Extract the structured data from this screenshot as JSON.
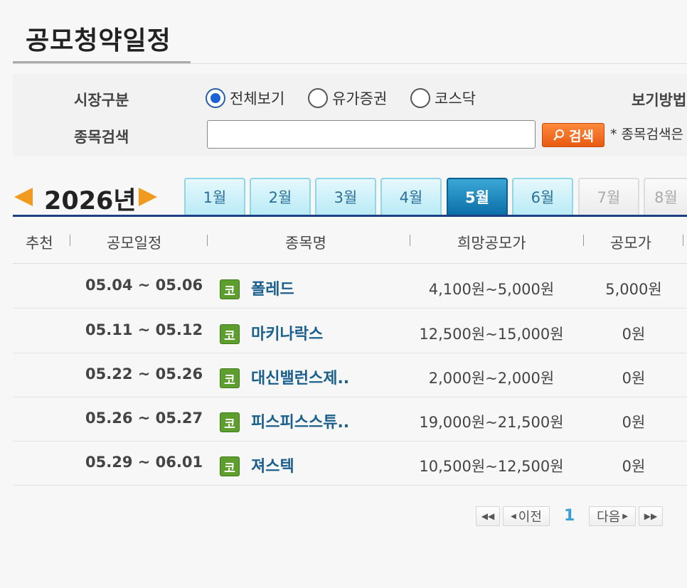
{
  "page": {
    "title": "공모청약일정"
  },
  "filter": {
    "market_label": "시장구분",
    "options": [
      {
        "label": "전체보기",
        "selected": true
      },
      {
        "label": "유가증권",
        "selected": false
      },
      {
        "label": "코스닥",
        "selected": false
      }
    ],
    "view_label": "보기방법",
    "search_label": "종목검색",
    "search_value": "",
    "search_button": "검색",
    "search_note": "* 종목검색은"
  },
  "calendar": {
    "year": "2026년",
    "months": [
      {
        "label": "1월",
        "state": "normal"
      },
      {
        "label": "2월",
        "state": "normal"
      },
      {
        "label": "3월",
        "state": "normal"
      },
      {
        "label": "4월",
        "state": "normal"
      },
      {
        "label": "5월",
        "state": "active"
      },
      {
        "label": "6월",
        "state": "normal"
      },
      {
        "label": "7월",
        "state": "disabled"
      },
      {
        "label": "8월",
        "state": "disabled"
      }
    ]
  },
  "table": {
    "headers": [
      "추천",
      "공모일정",
      "종목명",
      "희망공모가",
      "공모가"
    ],
    "rows": [
      {
        "recommend": "",
        "period": "05.04 ~ 05.06",
        "market": "코",
        "name": "폴레드",
        "hope_price": "4,100원~5,000원",
        "price": "5,000원"
      },
      {
        "recommend": "",
        "period": "05.11 ~ 05.12",
        "market": "코",
        "name": "마키나락스",
        "hope_price": "12,500원~15,000원",
        "price": "0원"
      },
      {
        "recommend": "",
        "period": "05.22 ~ 05.26",
        "market": "코",
        "name": "대신밸런스제..",
        "hope_price": "2,000원~2,000원",
        "price": "0원"
      },
      {
        "recommend": "",
        "period": "05.26 ~ 05.27",
        "market": "코",
        "name": "피스피스스튜..",
        "hope_price": "19,000원~21,500원",
        "price": "0원"
      },
      {
        "recommend": "",
        "period": "05.29 ~ 06.01",
        "market": "코",
        "name": "져스텍",
        "hope_price": "10,500원~12,500원",
        "price": "0원"
      }
    ]
  },
  "pagination": {
    "prev": "이전",
    "current": "1",
    "next": "다음"
  },
  "colors": {
    "accent": "#1c3f86",
    "active_tab": "#0b6fa7",
    "search_button": "#e85a10",
    "market_badge": "#5e9e2e",
    "stock_name": "#1a5f8d"
  }
}
